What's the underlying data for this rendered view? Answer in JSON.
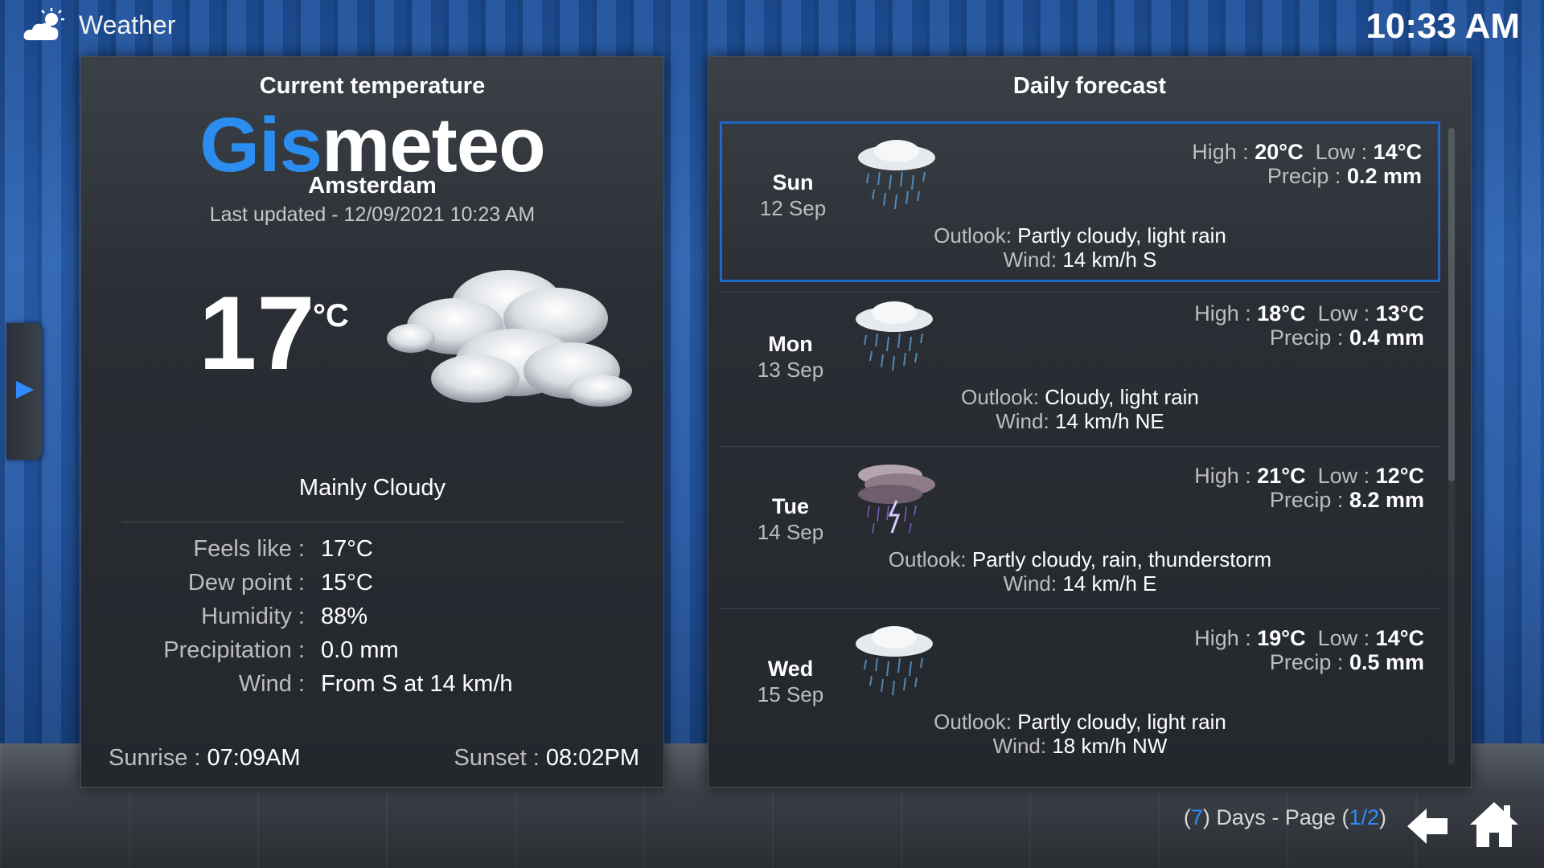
{
  "header": {
    "title": "Weather",
    "time": "10:33 AM",
    "logo_icon": "cloud-sun-icon"
  },
  "current": {
    "panel_title": "Current temperature",
    "brand_part1": "Gis",
    "brand_part2": "meteo",
    "city": "Amsterdam",
    "last_updated": "Last updated - 12/09/2021 10:23 AM",
    "temperature": "17",
    "unit": "°C",
    "condition": "Mainly Cloudy",
    "details": [
      {
        "label": "Feels like :",
        "value": "17°C"
      },
      {
        "label": "Dew point :",
        "value": "15°C"
      },
      {
        "label": "Humidity :",
        "value": "88%"
      },
      {
        "label": "Precipitation :",
        "value": "0.0 mm"
      },
      {
        "label": "Wind :",
        "value": "From S at 14 km/h"
      }
    ],
    "sunrise_label": "Sunrise :",
    "sunrise": "07:09AM",
    "sunset_label": "Sunset :",
    "sunset": "08:02PM"
  },
  "forecast": {
    "panel_title": "Daily forecast",
    "high_label": "High :",
    "low_label": "Low :",
    "precip_label": "Precip :",
    "outlook_label": "Outlook:",
    "wind_label": "Wind:",
    "days": [
      {
        "day": "Sun",
        "date": "12 Sep",
        "high": "20°C",
        "low": "14°C",
        "precip": "0.2 mm",
        "outlook": "Partly cloudy, light rain",
        "wind": "14 km/h S",
        "icon": "rain-cloud-icon"
      },
      {
        "day": "Mon",
        "date": "13 Sep",
        "high": "18°C",
        "low": "13°C",
        "precip": "0.4 mm",
        "outlook": "Cloudy, light rain",
        "wind": "14 km/h NE",
        "icon": "rain-cloud-icon"
      },
      {
        "day": "Tue",
        "date": "14 Sep",
        "high": "21°C",
        "low": "12°C",
        "precip": "8.2 mm",
        "outlook": "Partly cloudy, rain, thunderstorm",
        "wind": "14 km/h E",
        "icon": "thunderstorm-icon"
      },
      {
        "day": "Wed",
        "date": "15 Sep",
        "high": "19°C",
        "low": "14°C",
        "precip": "0.5 mm",
        "outlook": "Partly cloudy, light rain",
        "wind": "18 km/h NW",
        "icon": "rain-cloud-icon"
      }
    ]
  },
  "pager": {
    "open": "(",
    "days": "7",
    "mid": ") Days - Page (",
    "page": "1/2",
    "close": ")"
  }
}
